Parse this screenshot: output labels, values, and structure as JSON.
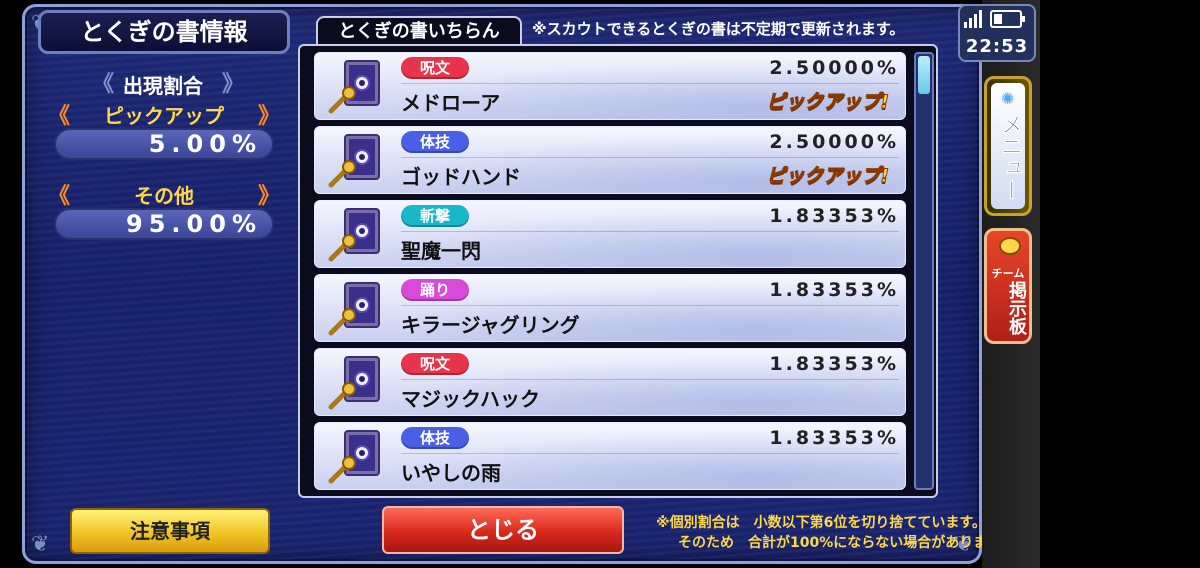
{
  "info_panel": {
    "title": "とくぎの書情報",
    "appearance_label": "出現割合",
    "pickup_label": "ピックアップ",
    "pickup_rate": "5.00%",
    "other_label": "その他",
    "other_rate": "95.00%"
  },
  "list": {
    "tab_label": "とくぎの書いちらん",
    "notice": "※スカウトできるとくぎの書は不定期で更新されます。",
    "items": [
      {
        "category": "呪文",
        "category_color": "#e8344a",
        "name": "メドローア",
        "rate": "2.50000%",
        "pickup": "ピックアップ!",
        "icon": "staff-icon"
      },
      {
        "category": "体技",
        "category_color": "#4a5fe8",
        "name": "ゴッドハンド",
        "rate": "2.50000%",
        "pickup": "ピックアップ!",
        "icon": "fist-icon"
      },
      {
        "category": "斬撃",
        "category_color": "#18b8c8",
        "name": "聖魔一閃",
        "rate": "1.83353%",
        "pickup": "",
        "icon": "sword-icon"
      },
      {
        "category": "踊り",
        "category_color": "#d84ad8",
        "name": "キラージャグリング",
        "rate": "1.83353%",
        "pickup": "",
        "icon": "dance-icon"
      },
      {
        "category": "呪文",
        "category_color": "#e8344a",
        "name": "マジックハック",
        "rate": "1.83353%",
        "pickup": "",
        "icon": "staff-icon"
      },
      {
        "category": "体技",
        "category_color": "#4a5fe8",
        "name": "いやしの雨",
        "rate": "1.83353%",
        "pickup": "",
        "icon": "fist-icon"
      }
    ]
  },
  "buttons": {
    "notice": "注意事項",
    "close": "とじる"
  },
  "footnote": {
    "line1": "※個別割合は　小数以下第6位を切り捨てています。",
    "line2": "そのため　合計が100%にならない場合があります。"
  },
  "status_bar": {
    "time": "22:53"
  },
  "side_menu": {
    "menu_label": "メニュー",
    "team_label": "チーム",
    "board_label": "掲示板"
  }
}
